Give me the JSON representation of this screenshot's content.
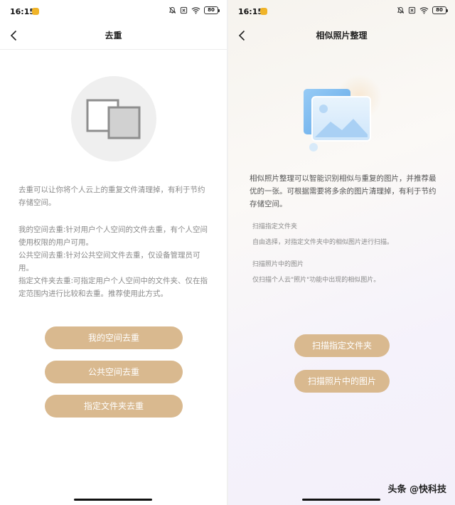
{
  "status_left": {
    "time": "16:15",
    "battery": "80"
  },
  "status_right": {
    "time": "16:15",
    "battery": "80"
  },
  "dedup": {
    "title": "去重",
    "intro": "去重可以让你将个人云上的重复文件清理掉，有利于节约存储空间。",
    "details": [
      "我的空间去重:针对用户个人空间的文件去重，有个人空间使用权限的用户可用。",
      "公共空间去重:针对公共空间文件去重，仅设备管理员可用。",
      "指定文件夹去重:可指定用户个人空间中的文件夹、仅在指定范围内进行比较和去重。推荐使用此方式。"
    ],
    "buttons": {
      "my_space": "我的空间去重",
      "public_space": "公共空间去重",
      "folder": "指定文件夹去重"
    }
  },
  "similar": {
    "title": "相似照片整理",
    "intro": "相似照片整理可以智能识别相似与重复的图片，并推荐最优的一张。可根据需要将多余的图片清理掉，有利于节约存储空间。",
    "folder_title": "扫描指定文件夹",
    "folder_desc": "自由选择，对指定文件夹中的相似图片进行扫描。",
    "photos_title": "扫描照片中的图片",
    "photos_desc": "仅扫描个人云\"照片\"功能中出现的相似图片。",
    "buttons": {
      "scan_folder": "扫描指定文件夹",
      "scan_photos": "扫描照片中的图片"
    }
  },
  "watermark": "头条 @快科技",
  "colors": {
    "button": "#d9b98f",
    "accent_blue": "#6fb4ee",
    "status_dot": "#f0b429"
  }
}
